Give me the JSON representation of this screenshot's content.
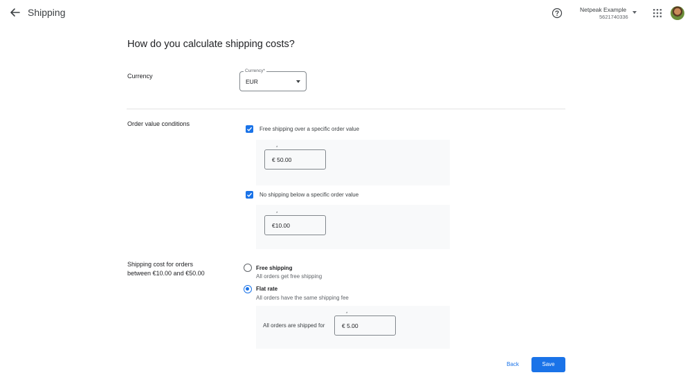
{
  "header": {
    "title": "Shipping",
    "account_name": "Netpeak Example",
    "account_id": "5621740336",
    "icons": {
      "back": "arrow-back-icon",
      "help": "help-icon",
      "apps": "apps-grid-icon",
      "avatar": "avatar"
    }
  },
  "page": {
    "heading": "How do you calculate shipping costs?"
  },
  "currency": {
    "section_label": "Currency",
    "field_label": "Currency",
    "required_mark": "*",
    "value": "EUR"
  },
  "order_conditions": {
    "section_label": "Order value conditions",
    "free_shipping": {
      "label": "Free shipping over a specific order value",
      "checked": true,
      "required_mark": "*",
      "value": "€ 50.00"
    },
    "no_shipping": {
      "label": "No shipping below a specific order value",
      "checked": true,
      "required_mark": "*",
      "value": "€10.00"
    }
  },
  "shipping_cost": {
    "section_label_line1": "Shipping cost for orders",
    "section_label_line2": "between €10.00 and €50.00",
    "options": [
      {
        "title": "Free shipping",
        "description": "All orders get free shipping",
        "selected": false
      },
      {
        "title": "Flat rate",
        "description": "All orders have the same shipping fee",
        "selected": true
      }
    ],
    "flat_rate": {
      "label": "All orders are shipped for",
      "required_mark": "*",
      "value": "€ 5.00"
    }
  },
  "footer": {
    "back_label": "Back",
    "save_label": "Save"
  },
  "colors": {
    "accent": "#1a73e8",
    "panel": "#f8f9fa",
    "divider": "#e3e3e3"
  }
}
